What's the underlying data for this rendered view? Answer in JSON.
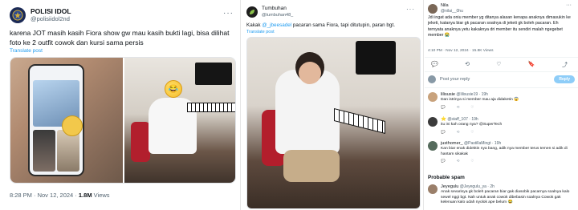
{
  "tweet1": {
    "display_name": "POLISI IDOL",
    "handle": "@polisiidol2nd",
    "text": "karena JOT masih kasih Fiora show gw mau kasih bukti lagi, bisa dilihat foto ke 2 outfit cowok dan kursi sama persis",
    "translate": "Translate post",
    "time": "8:28 PM · Nov 12, 2024 · ",
    "views_count": "1.8M",
    "views_label": " Views",
    "emoji": "😂"
  },
  "tweet2": {
    "display_name": "Tumbuhan",
    "handle": "@tumbuhan48_",
    "text_prefix": "Kakak ",
    "mention": "@_jbeesadel",
    "text_suffix": " pacaran sama Fiora, tapi ditutupin, paran bgt.",
    "translate": "Translate post"
  },
  "tweet3": {
    "display_name": "Nila",
    "handle": "@nilai__0hu",
    "text": "Jdi ingat ada oniu member yg ditanya alasan kenapa anaknya dimasukin ke jeketi, katanya biar gk pacaran soalnya di jeketi gk boleh pacaran. Eh ternyata anaknya yetu kakaknya dri member itu sendiri malah ngegebet member 😭",
    "meta": "4:10 PM · Nov 12, 2024 · 15.8K Views",
    "actions": [
      "💬",
      "⟲",
      "♡",
      "🔖",
      "⤴"
    ],
    "reply_placeholder": "Post your reply",
    "reply_button": "Reply",
    "comments": [
      {
        "name": "lilisusie",
        "handle": "@lilisusie19 · 19h",
        "text": "Dan istrinya si member mau aja didaketin 😱",
        "avatar_color": "#c8a27c"
      },
      {
        "name": "⭐",
        "handle": "@staff_107 · 19h",
        "text": "itu ini kah orang nya? @SuperTech",
        "avatar_color": "#3b3b3b"
      },
      {
        "name": "justhomer_",
        "handle": "@PastillaMingt · 19h",
        "text": "Kan biar enak didektin nya bang, adik nya member terus temen si adik di hantam sikakak",
        "avatar_color": "#556b5c"
      }
    ],
    "spam_heading": "Probable spam",
    "spam_comment": {
      "name": "Jeyegulu",
      "handle": "@Jeyegulu_ya · 2h",
      "text": "Anak sevarinya gk boleh pacaran biar gak diasobik pacarnya soalnya kalo sewel nggi bgt. Nah untuk anak cowok dibebasin soalnya Cowok gak kelenuan kalo udah nyolok ape belum 😂",
      "avatar_color": "#9a7f6a"
    }
  }
}
